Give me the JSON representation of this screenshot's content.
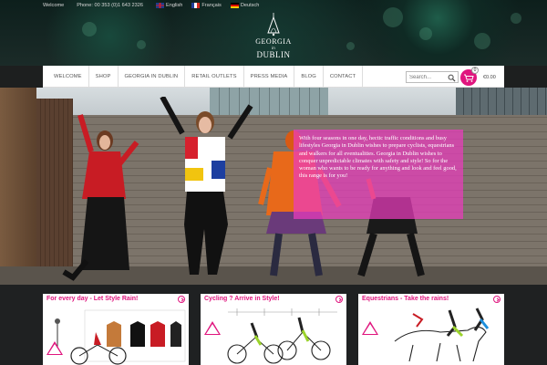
{
  "topbar": {
    "welcome": "Welcome",
    "phone": "Phone: 00 353 (0)1 643 2326",
    "languages": [
      {
        "label": "English",
        "flag": "uk-flag-icon"
      },
      {
        "label": "Français",
        "flag": "france-flag-icon"
      },
      {
        "label": "Deutsch",
        "flag": "germany-flag-icon"
      }
    ]
  },
  "logo": {
    "line1": "GEORGIA",
    "line2": "in",
    "line3": "DUBLIN"
  },
  "nav": {
    "items": [
      "WELCOME",
      "SHOP",
      "GEORGIA IN DUBLIN",
      "RETAIL OUTLETS",
      "PRESS MEDIA",
      "BLOG",
      "CONTACT"
    ]
  },
  "search": {
    "placeholder": "Search..."
  },
  "cart": {
    "count": "0",
    "total": "€0.00"
  },
  "hero": {
    "overlay_text": "With four seasons in one day, hectic traffic conditions and busy lifestyles Georgia in Dublin wishes to prepare cyclists, equestrians and walkers for all eventualities. Georgia in Dublin wishes to conquer unpredictable climates with safety and style! So for the woman who wants to be ready for anything and look and feel good, this range is for you!"
  },
  "panels": [
    {
      "title": "For every day - Let Style Rain!"
    },
    {
      "title": "Cycling ? Arrive in Style!"
    },
    {
      "title": "Equestrians - Take the rains!"
    }
  ],
  "colors": {
    "accent": "#e0157e",
    "overlay": "#eb3cbe"
  }
}
